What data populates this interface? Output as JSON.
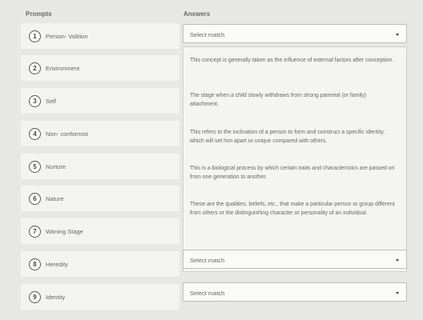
{
  "headers": {
    "prompts": "Prompts",
    "answers": "Answers"
  },
  "prompts": [
    {
      "num": "1",
      "label": "Person- Volition"
    },
    {
      "num": "2",
      "label": "Environment"
    },
    {
      "num": "3",
      "label": "Self"
    },
    {
      "num": "4",
      "label": "Non- conformist"
    },
    {
      "num": "5",
      "label": "Nurture"
    },
    {
      "num": "6",
      "label": "Nature"
    },
    {
      "num": "7",
      "label": "Waning Stage"
    },
    {
      "num": "8",
      "label": "Heredity"
    },
    {
      "num": "9",
      "label": "Identity"
    }
  ],
  "answers": {
    "select_placeholder": "Select match",
    "texts": [
      "This concept is generally taken as the influence of external factors after conception.",
      "The stage when a child slowly withdraws from strong parental (or family) attachment.",
      "This refers to the inclination of a person to form and construct a specific identity, which will set him apart or unique compared with others.",
      "This is a biological process by which certain traits and characteristics are passed on from one generation to another.",
      "These are the qualities, beliefs, etc., that make a particular person or group different from others or the distinguishing character or personality of an individual."
    ]
  }
}
